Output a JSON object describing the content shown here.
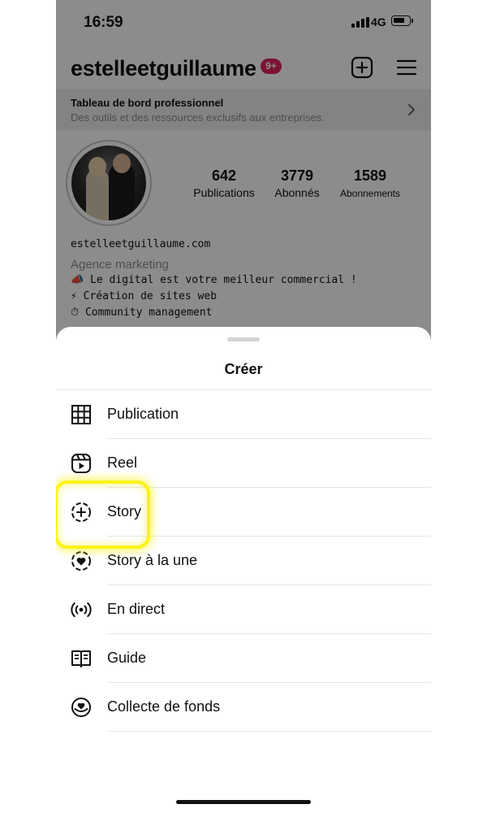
{
  "status_bar": {
    "time": "16:59",
    "network": "4G"
  },
  "profile": {
    "username": "estelleetguillaume",
    "notification_count": "9+",
    "dashboard": {
      "title": "Tableau de bord professionnel",
      "subtitle": "Des outils et des ressources exclusifs aux entreprises."
    },
    "stats": [
      {
        "value": "642",
        "label": "Publications"
      },
      {
        "value": "3779",
        "label": "Abonnés"
      },
      {
        "value": "1589",
        "label": "Abonnements"
      }
    ],
    "bio": {
      "website": "estelleetguillaume.com",
      "category": "Agence marketing",
      "lines": [
        {
          "icon": "📣",
          "text": "Le digital est votre meilleur commercial !"
        },
        {
          "icon": "⚡",
          "text": "Création de sites web"
        },
        {
          "icon": "⏱",
          "text": "Community management"
        }
      ]
    }
  },
  "create_sheet": {
    "title": "Créer",
    "items": [
      {
        "label": "Publication",
        "icon": "grid-icon"
      },
      {
        "label": "Reel",
        "icon": "reel-icon"
      },
      {
        "label": "Story",
        "icon": "story-add-icon"
      },
      {
        "label": "Story à la une",
        "icon": "highlight-heart-icon"
      },
      {
        "label": "En direct",
        "icon": "live-icon"
      },
      {
        "label": "Guide",
        "icon": "guide-icon"
      },
      {
        "label": "Collecte de fonds",
        "icon": "fundraiser-icon"
      }
    ]
  },
  "colors": {
    "badge": "#e0245e",
    "highlight": "#fbf31a"
  }
}
